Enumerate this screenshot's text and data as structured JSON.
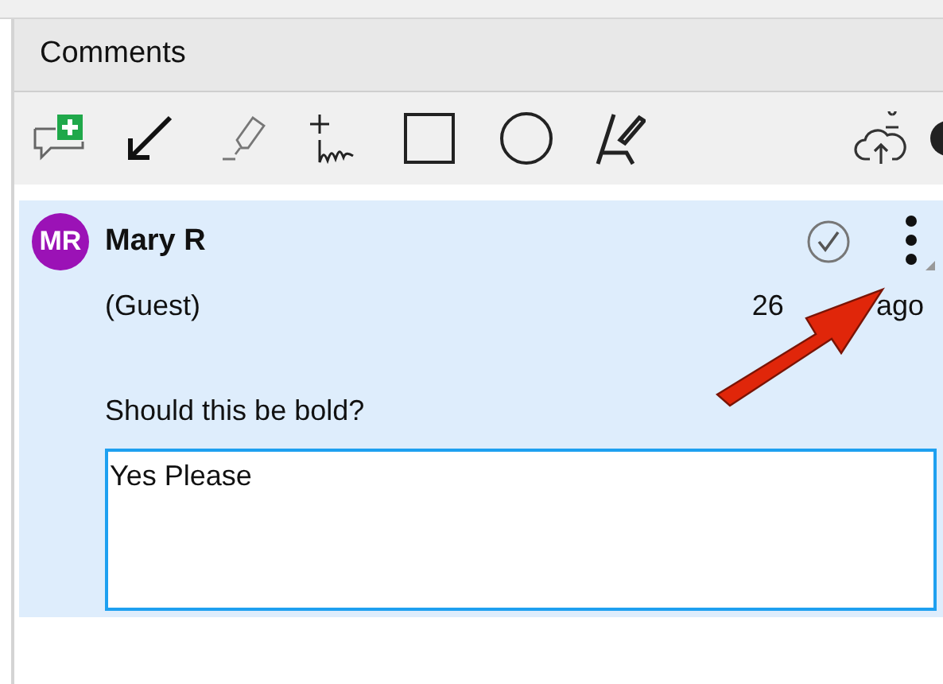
{
  "panel": {
    "title": "Comments"
  },
  "comment": {
    "initials": "MR",
    "author": "Mary R",
    "role": "(Guest)",
    "time_start": "26",
    "time_end": "ago",
    "text": "Should this be bold?",
    "reply": {
      "value": "Yes Please"
    }
  }
}
